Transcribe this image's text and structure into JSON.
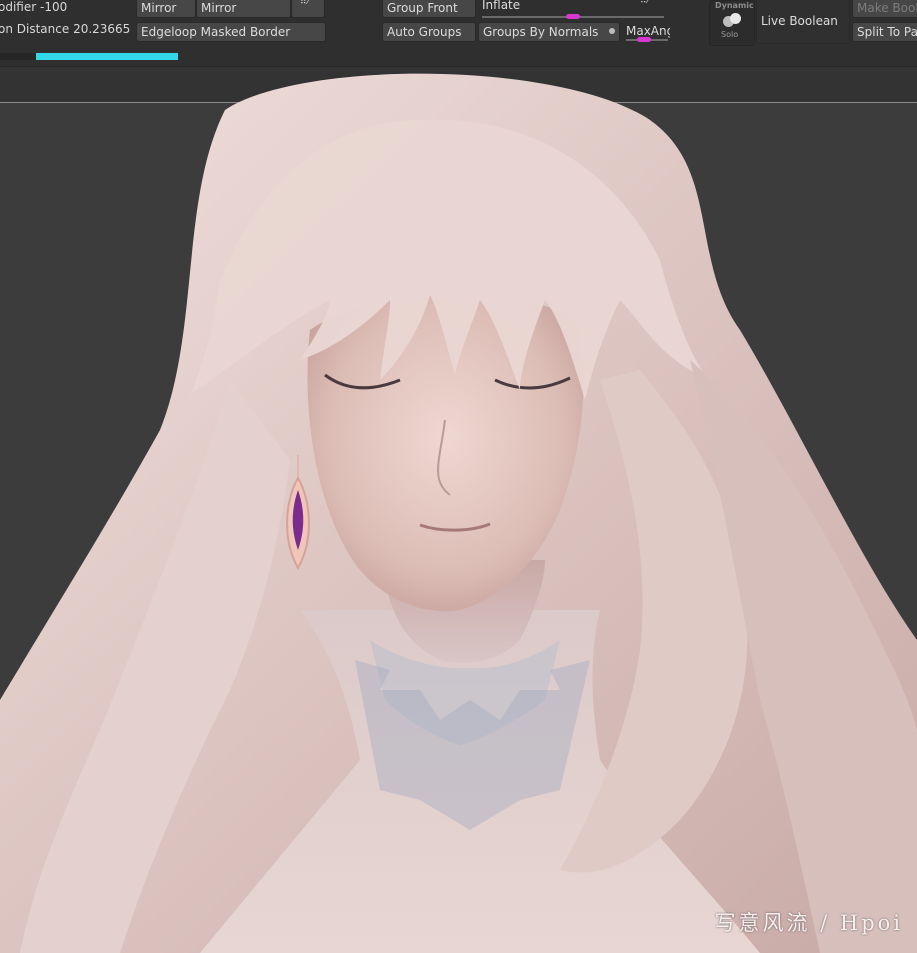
{
  "toolbar": {
    "modifier_label": "odifier",
    "modifier_value": "-100",
    "distance_label": "on Distance",
    "distance_value": "20.23665",
    "mirror_1": "Mirror",
    "mirror_2": "Mirror",
    "edgeloop_masked_border": "Edgeloop Masked Border",
    "group_front": "Group Front",
    "auto_groups": "Auto Groups",
    "inflate_label": "Inflate",
    "groups_by_normals": "Groups By Normals",
    "max_angle_label": "MaxAng",
    "dynamic_label": "Dynamic",
    "solo_label": "Solo",
    "live_boolean": "Live Boolean",
    "make_boolean": "Make Bool",
    "split_to_parts": "Split To Par",
    "progress": 1.0
  },
  "viewport": {
    "watermark": "写意风流 / Hpoi"
  },
  "colors": {
    "accent_cyan": "#33d8e8",
    "slider_magenta": "#d838d0",
    "hair": "#e6d2cf",
    "skin": "#e4c8c2"
  }
}
